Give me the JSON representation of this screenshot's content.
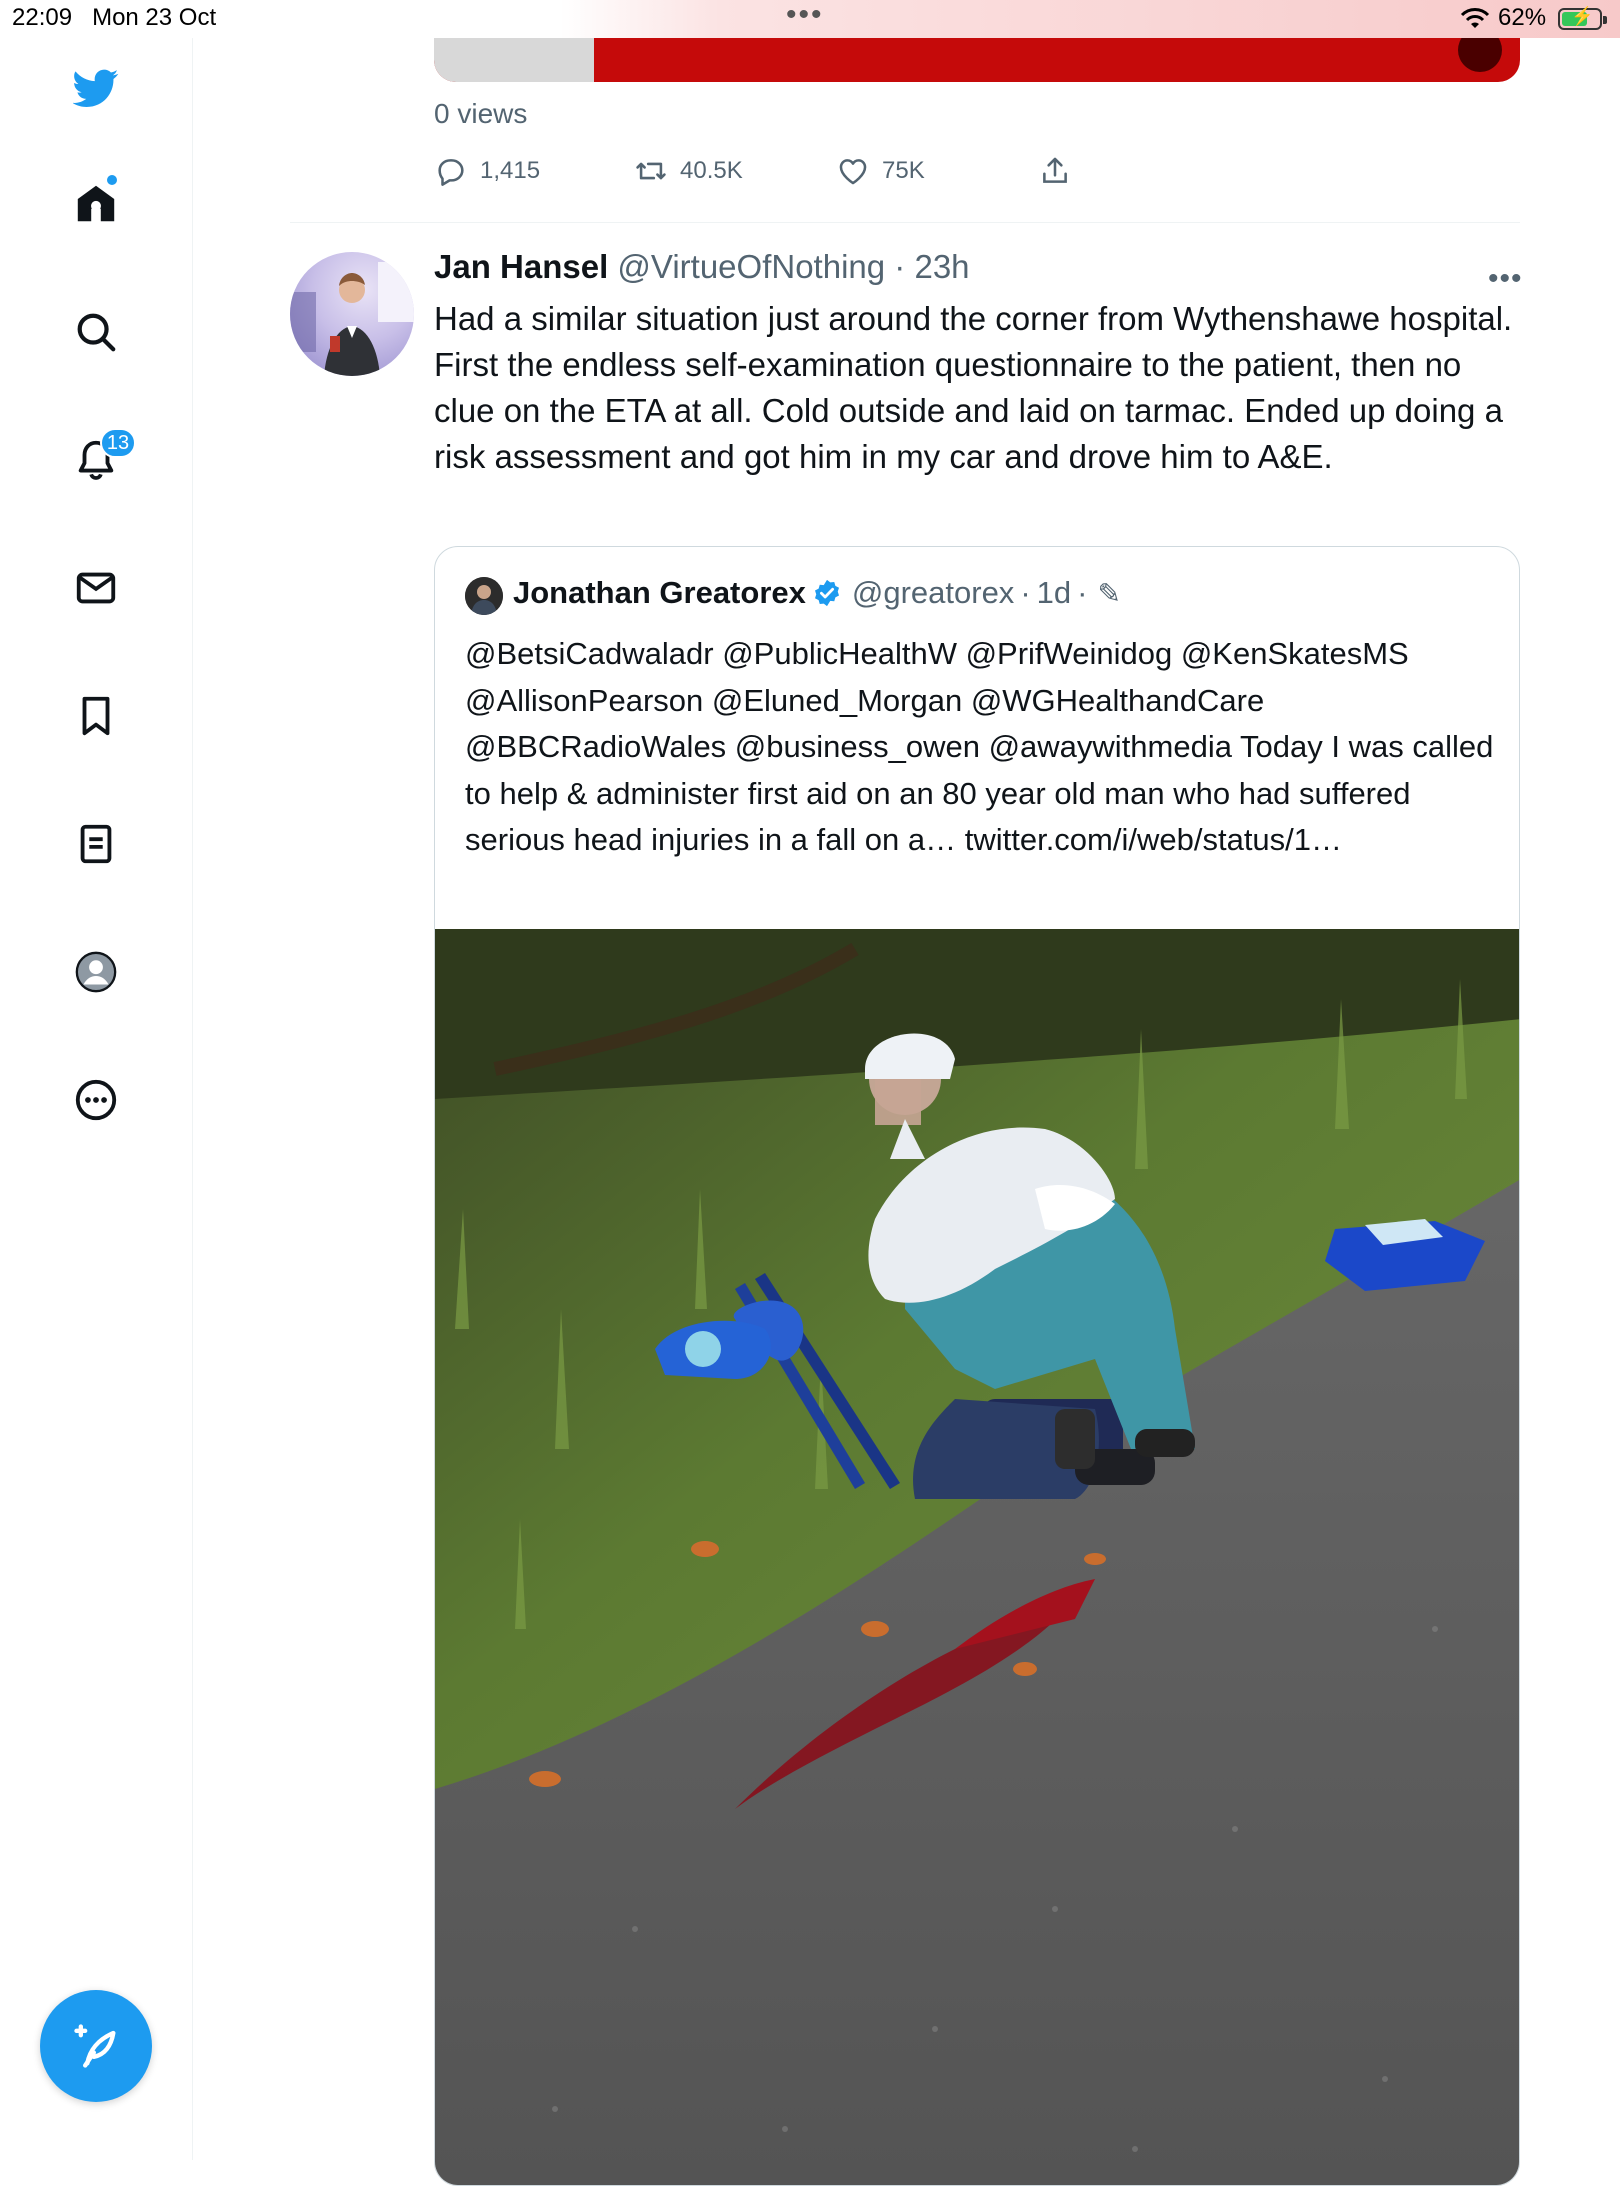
{
  "status_bar": {
    "time": "22:09",
    "date": "Mon 23 Oct",
    "battery_percent": "62%",
    "multitask_dots": "•••"
  },
  "sidebar": {
    "items": [
      {
        "name": "twitter-logo",
        "icon": "bird-icon"
      },
      {
        "name": "home",
        "icon": "home-icon"
      },
      {
        "name": "explore",
        "icon": "search-icon"
      },
      {
        "name": "notifications",
        "icon": "bell-icon",
        "badge": "13"
      },
      {
        "name": "messages",
        "icon": "mail-icon"
      },
      {
        "name": "bookmarks",
        "icon": "bookmark-icon"
      },
      {
        "name": "lists",
        "icon": "list-icon"
      },
      {
        "name": "profile",
        "icon": "profile-icon"
      },
      {
        "name": "more",
        "icon": "more-circle-icon"
      }
    ],
    "compose_icon": "feather-plus-icon"
  },
  "previous_tweet": {
    "views": "0 views",
    "replies": "1,415",
    "retweets": "40.5K",
    "likes": "75K"
  },
  "tweet": {
    "author_name": "Jan Hansel",
    "author_handle": "@VirtueOfNothing",
    "separator": "·",
    "time": "23h",
    "more": "•••",
    "text": "Had a similar situation just around the corner from Wythenshawe hospital. First the endless self-examination questionnaire to the patient, then no clue on the ETA at all. Cold outside and laid on tarmac. Ended up doing a risk assessment and got him in my car and drove him to A&E."
  },
  "quoted_tweet": {
    "author_name": "Jonathan Greatorex",
    "author_handle": "@greatorex",
    "separator": "·",
    "time": "1d",
    "separator2": "·",
    "text": "@BetsiCadwaladr @PublicHealthW @PrifWeinidog @KenSkatesMS @AllisonPearson @Eluned_Morgan @WGHealthandCare @BBCRadioWales @business_owen @awaywithmedia  Today I was called to help & administer first aid on an 80 year old man who had suffered serious head injuries in a fall on a… twitter.com/i/web/status/1…"
  },
  "colors": {
    "accent": "#1d9bf0",
    "text_primary": "#0f1419",
    "text_secondary": "#536471",
    "border": "#cfd9de"
  }
}
